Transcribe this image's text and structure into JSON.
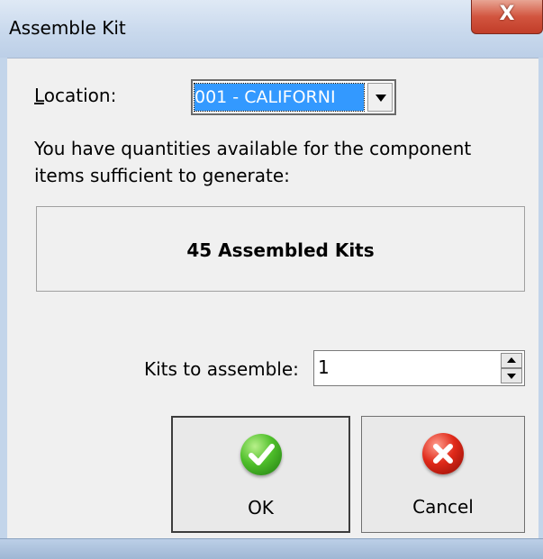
{
  "window": {
    "title": "Assemble Kit",
    "close_glyph": "X"
  },
  "location": {
    "label_prefix": "",
    "label_accel": "L",
    "label_rest": "ocation:",
    "selected": "001 - CALIFORNI"
  },
  "info": {
    "text": "You have quantities available for the component items sufficient to generate:"
  },
  "summary": {
    "text": "45 Assembled Kits"
  },
  "assemble": {
    "label": "Kits to assemble:",
    "value": "1"
  },
  "buttons": {
    "ok_label": "OK",
    "ok_icon": "check-icon",
    "cancel_label": "Cancel",
    "cancel_icon": "x-icon"
  },
  "colors": {
    "selection": "#3399ff",
    "ok_green": "#4fbf2b",
    "cancel_red": "#e02a1a",
    "close_red": "#d2553f"
  }
}
